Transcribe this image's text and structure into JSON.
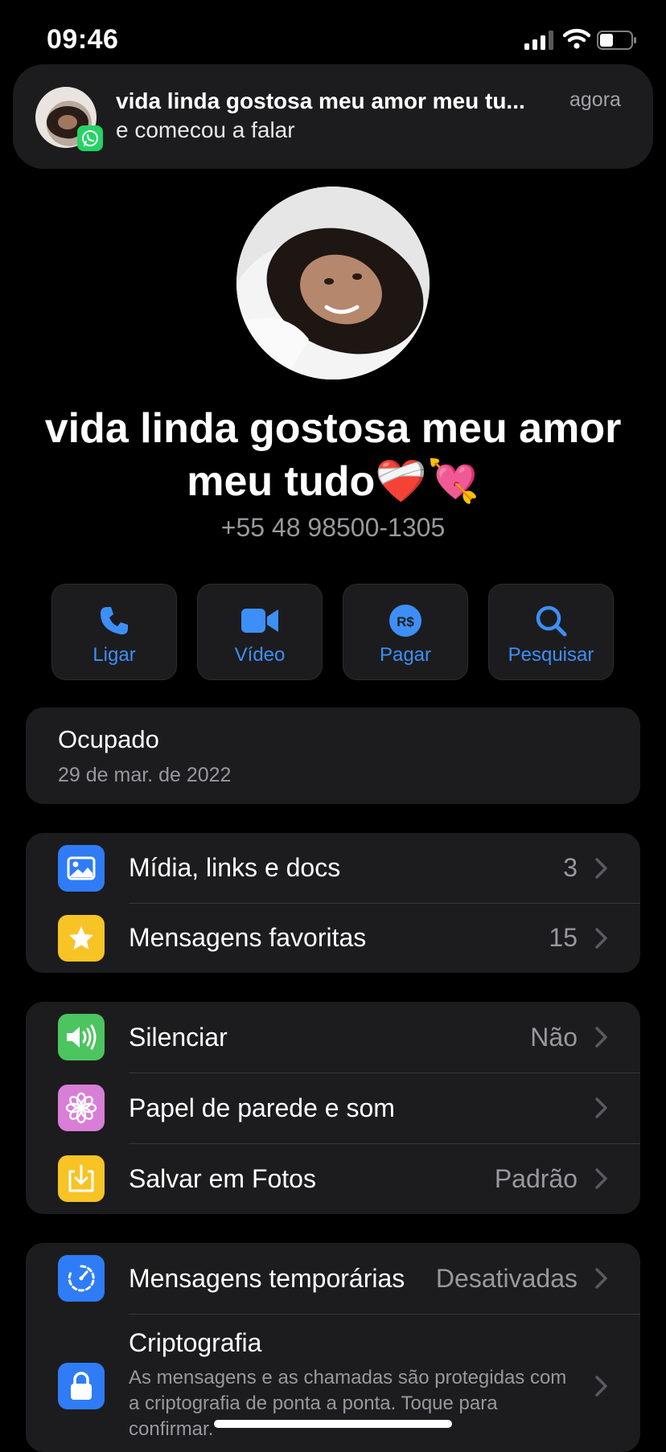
{
  "status_bar": {
    "time": "09:46"
  },
  "notification": {
    "title": "vida linda gostosa meu amor meu tu...",
    "time": "agora",
    "body": "e comecou a falar"
  },
  "contact": {
    "name": "vida linda gostosa meu amor meu tudo❤️‍🩹💘",
    "phone": "+55 48 98500-1305"
  },
  "actions": [
    {
      "label": "Ligar",
      "icon": "phone-icon"
    },
    {
      "label": "Vídeo",
      "icon": "video-icon"
    },
    {
      "label": "Pagar",
      "icon": "payment-icon"
    },
    {
      "label": "Pesquisar",
      "icon": "search-icon"
    }
  ],
  "about": {
    "status": "Ocupado",
    "date": "29 de mar. de 2022"
  },
  "group1": [
    {
      "label": "Mídia, links e docs",
      "value": "3",
      "icon": "media-icon",
      "color": "#2f7cf6"
    },
    {
      "label": "Mensagens favoritas",
      "value": "15",
      "icon": "star-icon",
      "color": "#f7c325"
    }
  ],
  "group2": [
    {
      "label": "Silenciar",
      "value": "Não",
      "icon": "speaker-icon",
      "color": "#4cc45f"
    },
    {
      "label": "Papel de parede e som",
      "value": "",
      "icon": "flower-icon",
      "color": "#d87ed6"
    },
    {
      "label": "Salvar em Fotos",
      "value": "Padrão",
      "icon": "download-icon",
      "color": "#f7c325"
    }
  ],
  "group3": [
    {
      "label": "Mensagens temporárias",
      "value": "Desativadas",
      "icon": "timer-icon",
      "color": "#2f7cf6"
    },
    {
      "label": "Criptografia",
      "description": "As mensagens e as chamadas são protegidas com a criptografia de ponta a ponta. Toque para confirmar.",
      "icon": "lock-icon",
      "color": "#2f7cf6"
    }
  ],
  "colors": {
    "accent": "#3d8ff7",
    "card": "#1c1c1e",
    "background": "#000000"
  }
}
